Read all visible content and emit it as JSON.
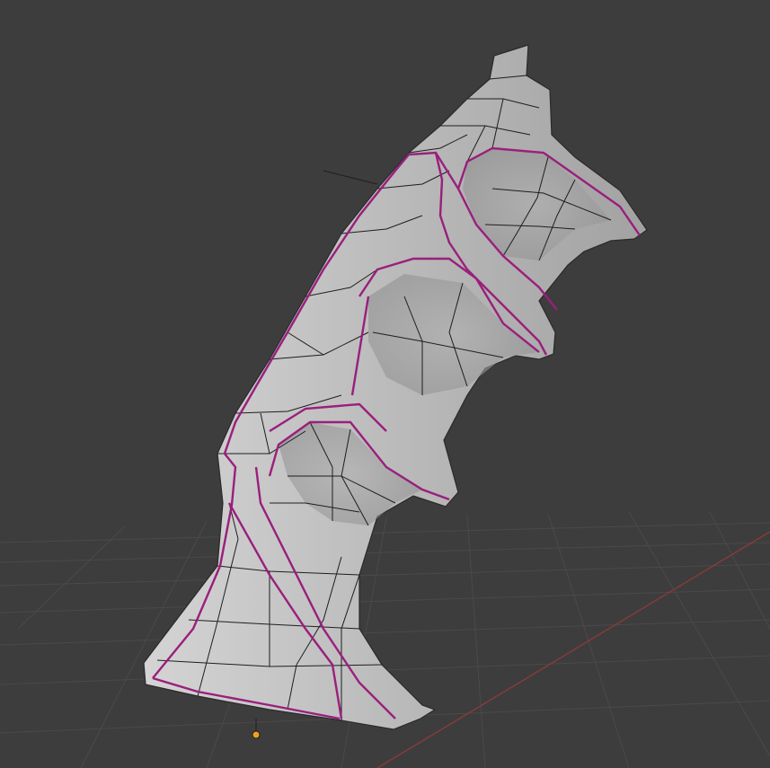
{
  "viewport": {
    "background": "#3d3d3d",
    "grid_color": "#4a4a4a",
    "x_axis_color": "#8a3a3a",
    "mesh_fill": "#b9b9b9",
    "mesh_edge_color": "#1e1e1e",
    "seam_color": "#9a1f7c",
    "origin_color": "#f0a020"
  },
  "object": {
    "name_icon": "mesh-object",
    "shading": "solid",
    "seams_visible": true
  }
}
